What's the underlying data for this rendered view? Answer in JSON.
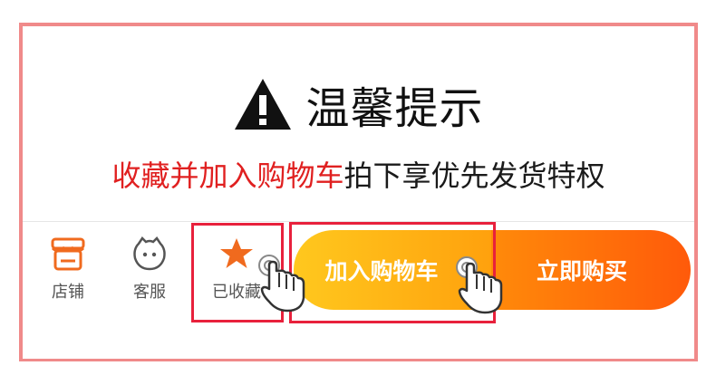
{
  "header": {
    "title": "温馨提示"
  },
  "promo": {
    "highlight": "收藏并加入购物车",
    "rest": "拍下享优先发货特权"
  },
  "bottom_bar": {
    "store_label": "店铺",
    "service_label": "客服",
    "favorited_label": "已收藏",
    "add_to_cart_label": "加入购物车",
    "buy_now_label": "立即购买"
  },
  "colors": {
    "frame": "#f08a8a",
    "highlight_text": "#e02020",
    "icon_orange": "#f06a1e",
    "highlight_box": "#e8213c",
    "cart_button": "#ffb416",
    "buy_button": "#ff6a0a"
  },
  "icons": [
    "warning-icon",
    "store-icon",
    "service-face-icon",
    "star-icon",
    "tap-hand-icon"
  ]
}
